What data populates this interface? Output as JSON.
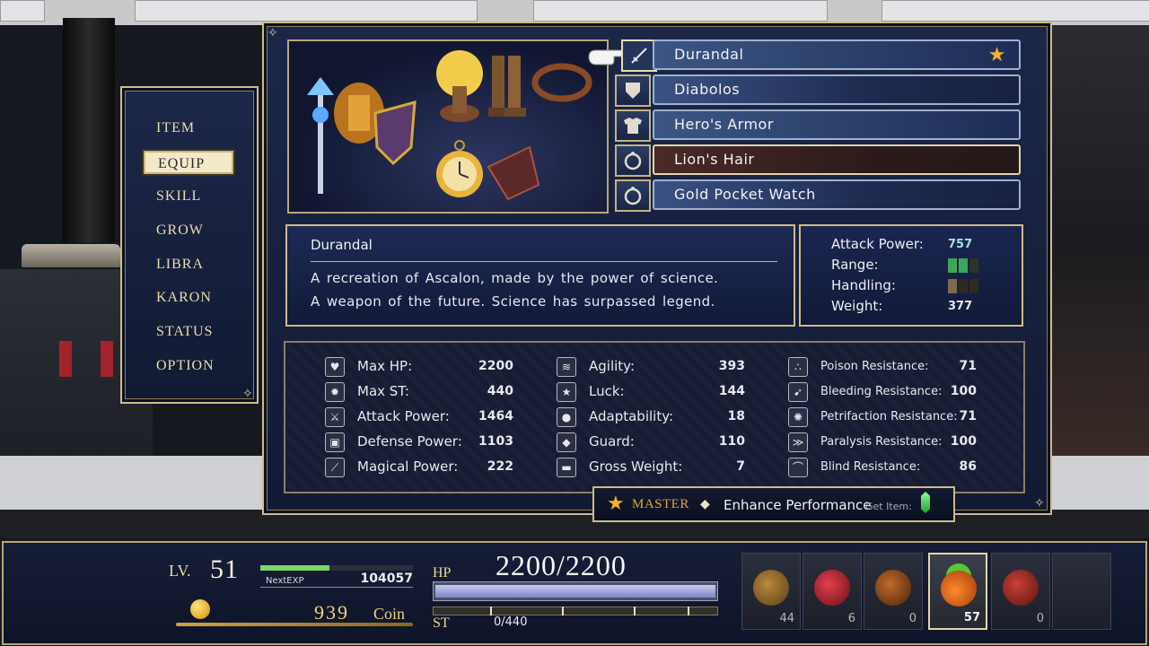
{
  "menu": {
    "items": [
      {
        "label": "ITEM",
        "active": false
      },
      {
        "label": "EQUIP",
        "active": true
      },
      {
        "label": "SKILL",
        "active": false
      },
      {
        "label": "GROW",
        "active": false
      },
      {
        "label": "LIBRA",
        "active": false
      },
      {
        "label": "KARON",
        "active": false
      },
      {
        "label": "STATUS",
        "active": false
      },
      {
        "label": "OPTION",
        "active": false
      }
    ]
  },
  "equipment": {
    "slots": [
      {
        "icon": "sword-icon",
        "name": "Durandal",
        "starred": true
      },
      {
        "icon": "shield-icon",
        "name": "Diabolos"
      },
      {
        "icon": "armor-icon",
        "name": "Hero's Armor"
      },
      {
        "icon": "ring-icon",
        "name": "Lion's Hair"
      },
      {
        "icon": "ring-icon",
        "name": "Gold Pocket Watch"
      }
    ]
  },
  "description": {
    "title": "Durandal",
    "line1": "A recreation of Ascalon, made by the power of science.",
    "line2": "A weapon of the future. Science has surpassed legend."
  },
  "weapon_stats": {
    "attack_label": "Attack Power:",
    "attack_value": "757",
    "range_label": "Range:",
    "range_level": 2,
    "handling_label": "Handling:",
    "handling_level": 1,
    "weight_label": "Weight:",
    "weight_value": "377"
  },
  "stats": {
    "col1": [
      {
        "icon": "heart-icon",
        "label": "Max HP:",
        "value": "2200"
      },
      {
        "icon": "burst-icon",
        "label": "Max ST:",
        "value": "440"
      },
      {
        "icon": "sword-icon",
        "label": "Attack Power:",
        "value": "1464"
      },
      {
        "icon": "armor-icon",
        "label": "Defense Power:",
        "value": "1103"
      },
      {
        "icon": "wand-icon",
        "label": "Magical Power:",
        "value": "222"
      }
    ],
    "col2": [
      {
        "icon": "wing-icon",
        "label": "Agility:",
        "value": "393"
      },
      {
        "icon": "star-icon",
        "label": "Luck:",
        "value": "144"
      },
      {
        "icon": "drop-icon",
        "label": "Adaptability:",
        "value": "18"
      },
      {
        "icon": "shield-icon",
        "label": "Guard:",
        "value": "110"
      },
      {
        "icon": "weight-icon",
        "label": "Gross Weight:",
        "value": "7"
      }
    ],
    "col3": [
      {
        "icon": "poison-icon",
        "label": "Poison Resistance:",
        "value": "71"
      },
      {
        "icon": "bleed-icon",
        "label": "Bleeding Resistance:",
        "value": "100"
      },
      {
        "icon": "petrify-icon",
        "label": "Petrifaction Resistance:",
        "value": "71"
      },
      {
        "icon": "paralysis-icon",
        "label": "Paralysis Resistance:",
        "value": "100"
      },
      {
        "icon": "blind-icon",
        "label": "Blind Resistance:",
        "value": "86"
      }
    ]
  },
  "master_banner": {
    "label": "MASTER",
    "text": "Enhance Performance",
    "get_item": "Get Item:"
  },
  "hud": {
    "lv_label": "LV.",
    "level": "51",
    "next_exp_label": "NextEXP",
    "next_exp_value": "104057",
    "exp_progress": 0.45,
    "coins": "939",
    "coin_label": "Coin",
    "hp_label": "HP",
    "hp_value": "2200/2200",
    "hp_fraction": 1.0,
    "st_label": "ST",
    "st_value": "0/440",
    "items": [
      {
        "icon": "seed-icon",
        "count": "44",
        "color": "#7a5a2a"
      },
      {
        "icon": "potion-icon",
        "count": "6",
        "color": "#b8202a"
      },
      {
        "icon": "fruit-icon",
        "count": "0",
        "color": "#8a4a1c"
      },
      {
        "icon": "pineapple-icon",
        "count": "57",
        "color": "#e0631a",
        "selected": true
      },
      {
        "icon": "potion-red-icon",
        "count": "0",
        "color": "#9a2a22"
      }
    ]
  }
}
